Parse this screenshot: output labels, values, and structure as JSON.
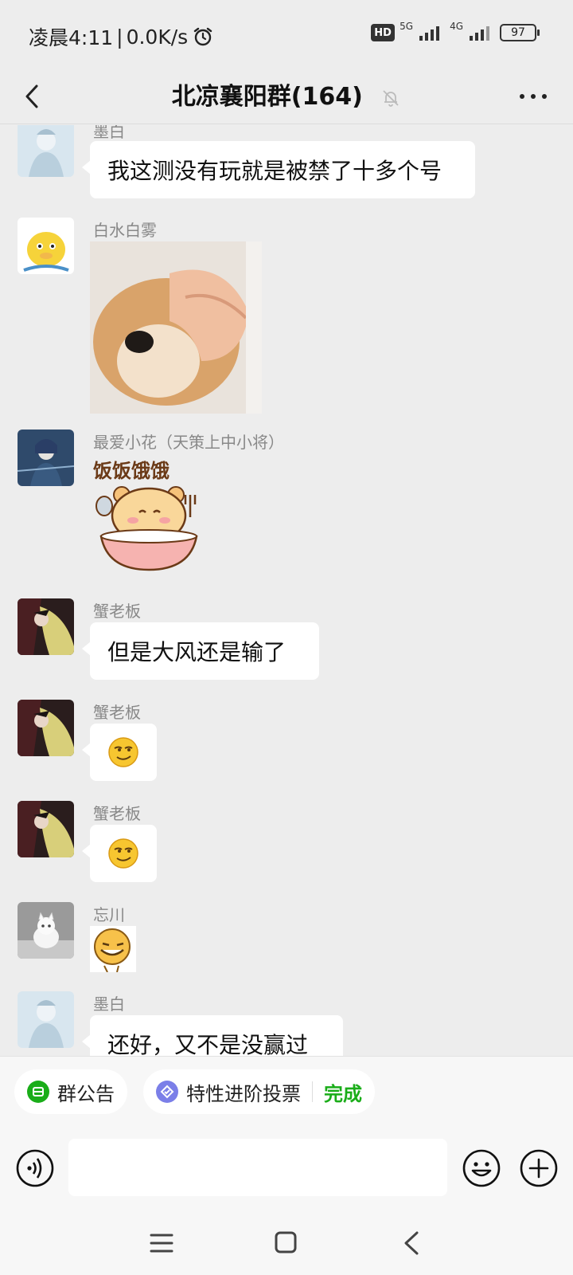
{
  "status": {
    "time": "凌晨4:11",
    "speed": "0.0K/s",
    "hd": "HD",
    "net5g": "5G",
    "net4g": "4G",
    "battery": "97"
  },
  "header": {
    "title": "北凉襄阳群(164)"
  },
  "messages": [
    {
      "sender": "墨白",
      "text": "我这测没有玩就是被禁了十多个号"
    },
    {
      "sender": "白水白雾",
      "image": "dog-face-sticker"
    },
    {
      "sender": "最爱小花（天策上中小将）",
      "sticker_text": "饭饭饿饿"
    },
    {
      "sender": "蟹老板",
      "text": "但是大风还是输了"
    },
    {
      "sender": "蟹老板",
      "emoji": "smirk-emoji"
    },
    {
      "sender": "蟹老板",
      "emoji": "smirk-emoji"
    },
    {
      "sender": "忘川",
      "emoji": "grin-sticker"
    },
    {
      "sender": "墨白",
      "text": "还好，又不是没赢过"
    }
  ],
  "pills": {
    "notice": "群公告",
    "vote": "特性进阶投票",
    "vote_action": "完成"
  },
  "input": {
    "value": "",
    "placeholder": ""
  },
  "colors": {
    "accent_green": "#1aad19",
    "background": "#ededed"
  }
}
